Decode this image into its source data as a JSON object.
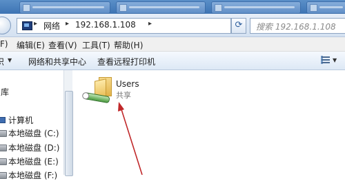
{
  "taskbar": {
    "tabs": [
      "",
      "",
      "",
      ""
    ]
  },
  "address_bar": {
    "crumbs": [
      "网络",
      "192.168.1.108"
    ],
    "search_placeholder": "搜索 192.168.1.108"
  },
  "menu": {
    "items": [
      "F)",
      "编辑(E)",
      "查看(V)",
      "工具(T)",
      "帮助(H)"
    ]
  },
  "toolbar": {
    "organize_fragment": "织",
    "network_center": "网络和共享中心",
    "view_printers": "查看远程打印机"
  },
  "nav": {
    "library_fragment": "库",
    "computer": "计算机",
    "drives": [
      "本地磁盘 (C:)",
      "本地磁盘 (D:)",
      "本地磁盘 (E:)",
      "本地磁盘 (F:)"
    ]
  },
  "content": {
    "items": [
      {
        "name": "Users",
        "subtitle": "共享",
        "icon": "shared-folder-icon"
      }
    ]
  },
  "colors": {
    "annotation_arrow": "#c0282a",
    "window_chrome": "#d4e1f1"
  }
}
